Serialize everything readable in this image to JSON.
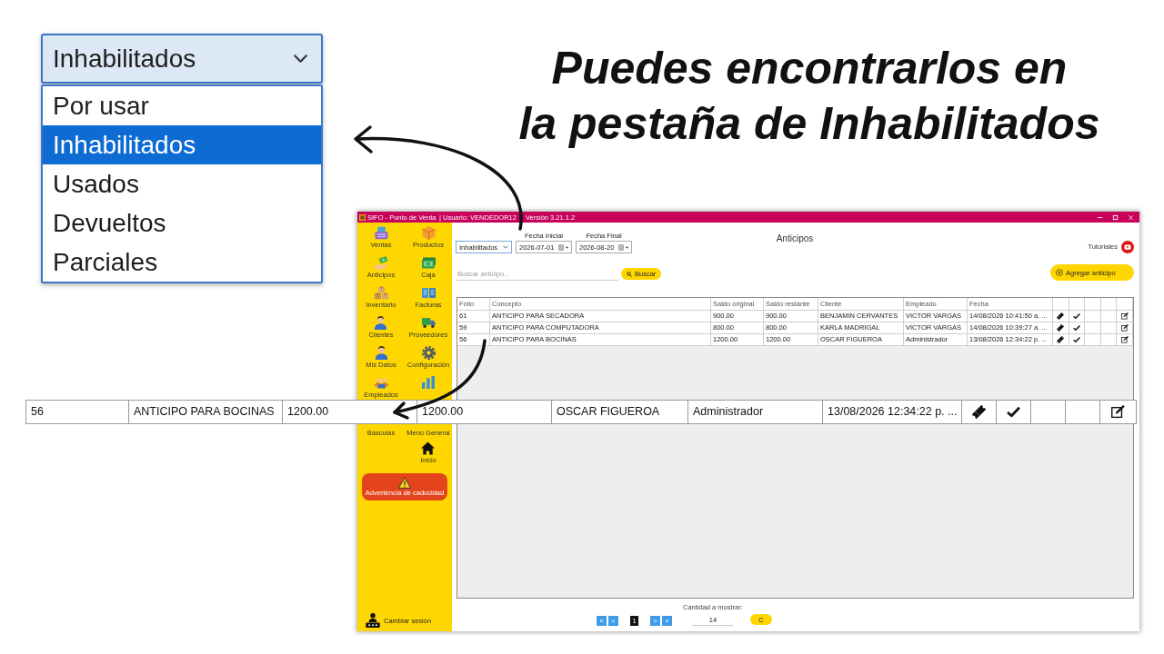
{
  "dropdown": {
    "value": "Inhabilitados",
    "options": [
      {
        "label": "Por usar",
        "selected": false
      },
      {
        "label": "Inhabilitados",
        "selected": true
      },
      {
        "label": "Usados",
        "selected": false
      },
      {
        "label": "Devueltos",
        "selected": false
      },
      {
        "label": "Parciales",
        "selected": false
      }
    ]
  },
  "heading": {
    "lines": [
      "Puedes encontrarlos en",
      "la pestaña de Inhabilitados"
    ]
  },
  "app_window": {
    "title": "SIFO - Punto de Venta",
    "user": "| Usuario: VENDEDOR12",
    "version": "Versión 3.21.1.2",
    "sidebar": {
      "items": [
        {
          "label": "Ventas"
        },
        {
          "label": "Productos"
        },
        {
          "label": "Anticipos"
        },
        {
          "label": "Caja"
        },
        {
          "label": "Inventario"
        },
        {
          "label": "Facturas"
        },
        {
          "label": "Clientes"
        },
        {
          "label": "Proveedores"
        },
        {
          "label": "Mis Datos"
        },
        {
          "label": "Configuración"
        },
        {
          "label": "Empleados"
        },
        {
          "label": "Básculas"
        },
        {
          "label": "Menú General"
        },
        {
          "label": "Inicio"
        }
      ],
      "alert_button": "Advertencia de caducidad",
      "session_button": "Cambiar sesión"
    },
    "page_title": "Anticipos",
    "tutorials": "Tutoriales",
    "filters": {
      "status": "Inhabilitados",
      "start_date": {
        "label": "Fecha Inicial",
        "value": "2026-07-01"
      },
      "end_date": {
        "label": "Fecha Final",
        "value": "2026-08-20"
      }
    },
    "search": {
      "placeholder": "Buscar anticipo...",
      "button": "Buscar"
    },
    "add_button": "Agregar anticipo",
    "table": {
      "columns": [
        "Folio",
        "Concepto",
        "Saldo original",
        "Saldo restante",
        "Cliente",
        "Empleado",
        "Fecha"
      ],
      "rows": [
        {
          "cells": [
            "61",
            "ANTICIPO PARA SECADORA",
            "900.00",
            "900.00",
            "BENJAMIN CERVANTES",
            "VICTOR VARGAS",
            "14/08/2026 10:41:50 a. ..."
          ],
          "checked": true
        },
        {
          "cells": [
            "59",
            "ANTICIPO PARA COMPUTADORA",
            "800.00",
            "800.00",
            "KARLA MADRIGAL",
            "VICTOR VARGAS",
            "14/08/2026 10:39:27 a. ..."
          ],
          "checked": true
        },
        {
          "cells": [
            "56",
            "ANTICIPO PARA BOCINAS",
            "1200.00",
            "1200.00",
            "OSCAR FIGUEROA",
            "Administrador",
            "13/08/2026 12:34:22 p. ..."
          ],
          "checked": true
        }
      ]
    },
    "pagination": {
      "label": "Cantidad a mostrar:",
      "first": "«",
      "prev": "<",
      "page": "1",
      "next": ">",
      "last": "»",
      "count": "14",
      "refresh": "C"
    }
  },
  "zoomed_row": {
    "cells": [
      "56",
      "ANTICIPO PARA BOCINAS",
      "1200.00",
      "1200.00",
      "OSCAR FIGUEROA",
      "Administrador",
      "13/08/2026 12:34:22 p. ..."
    ],
    "checked": true
  }
}
